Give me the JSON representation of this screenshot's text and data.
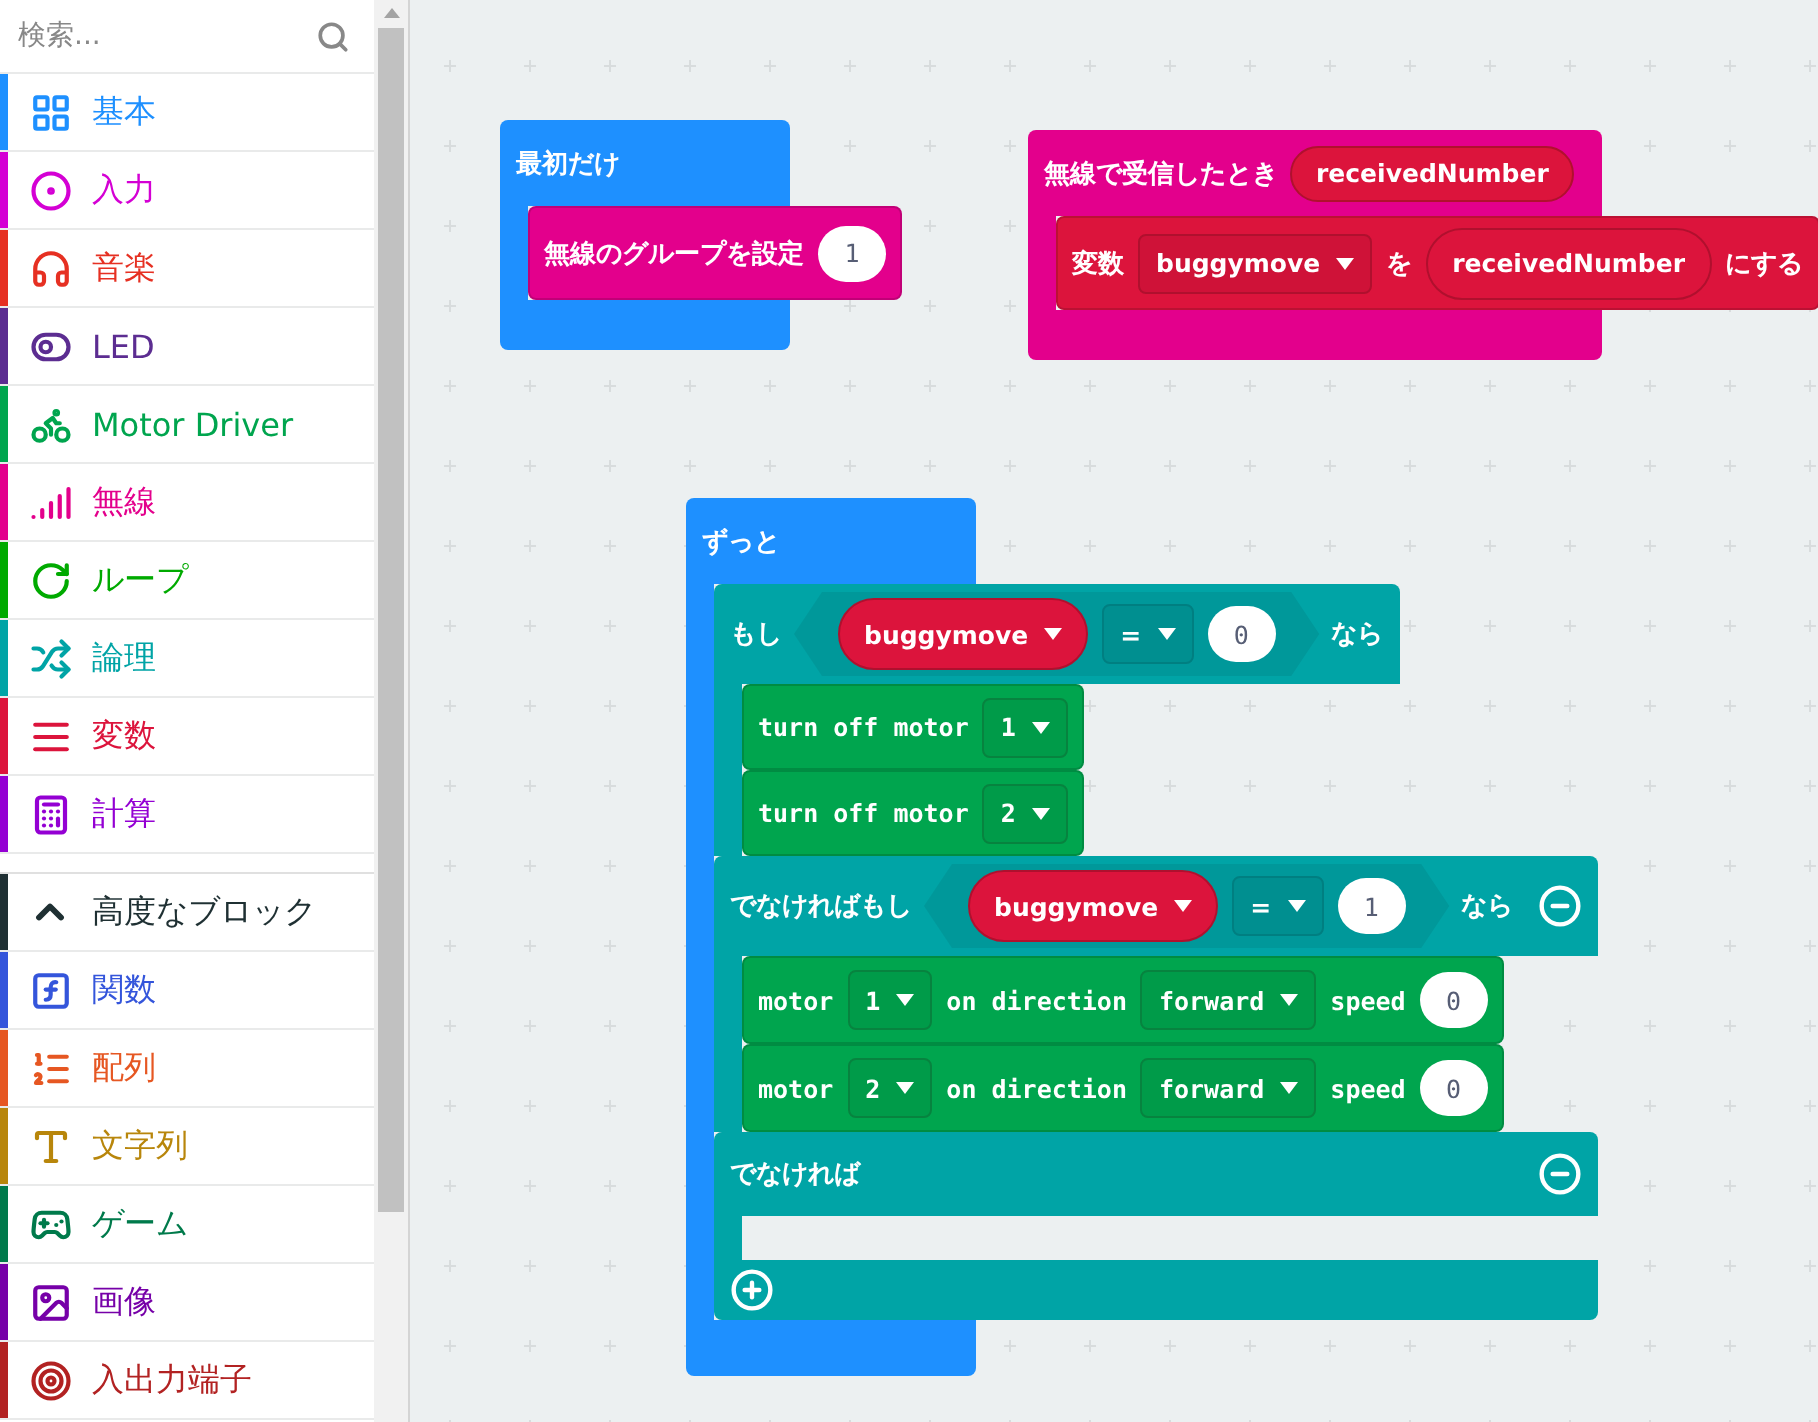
{
  "search": {
    "placeholder": "検索..."
  },
  "categories": [
    {
      "label": "基本",
      "color": "#1e90ff",
      "kind": "grid"
    },
    {
      "label": "入力",
      "color": "#d400d4",
      "kind": "target"
    },
    {
      "label": "音楽",
      "color": "#e63022",
      "kind": "headphones"
    },
    {
      "label": "LED",
      "color": "#5c2d91",
      "kind": "toggle"
    },
    {
      "label": "Motor Driver",
      "color": "#00a54e",
      "kind": "bike"
    },
    {
      "label": "無線",
      "color": "#e3008c",
      "kind": "signal"
    },
    {
      "label": "ループ",
      "color": "#00aa00",
      "kind": "loop"
    },
    {
      "label": "論理",
      "color": "#00a4a6",
      "kind": "shuffle"
    },
    {
      "label": "変数",
      "color": "#dc143c",
      "kind": "bars"
    },
    {
      "label": "計算",
      "color": "#9400d3",
      "kind": "calculator"
    }
  ],
  "advanced": {
    "label": "高度なブロック",
    "expanded": true
  },
  "advanced_categories": [
    {
      "label": "関数",
      "color": "#3455db",
      "kind": "function"
    },
    {
      "label": "配列",
      "color": "#e65722",
      "kind": "list"
    },
    {
      "label": "文字列",
      "color": "#b8860b",
      "kind": "text"
    },
    {
      "label": "ゲーム",
      "color": "#007a4b",
      "kind": "gamepad"
    },
    {
      "label": "画像",
      "color": "#7600a8",
      "kind": "image"
    },
    {
      "label": "入出力端子",
      "color": "#b22222",
      "kind": "pin"
    }
  ],
  "workspace": {
    "on_start": {
      "title": "最初だけ",
      "statement": {
        "label": "無線のグループを設定",
        "value": "1"
      }
    },
    "on_received": {
      "title": "無線で受信したとき",
      "parameter": "receivedNumber",
      "statement": {
        "label": "変数",
        "variable": "buggymove",
        "connector": "を",
        "value": "receivedNumber",
        "suffix": "にする"
      }
    },
    "forever": {
      "title": "ずっと",
      "if_block": {
        "branches": [
          {
            "label": "もし",
            "variable": "buggymove",
            "operator": "=",
            "value": "0",
            "then_label": "なら",
            "removable": false,
            "body": [
              {
                "kind": "turn_off",
                "label": "turn off motor",
                "motor": "1"
              },
              {
                "kind": "turn_off",
                "label": "turn off motor",
                "motor": "2"
              }
            ]
          },
          {
            "label": "でなければもし",
            "variable": "buggymove",
            "operator": "=",
            "value": "1",
            "then_label": "なら",
            "removable": true,
            "body": [
              {
                "kind": "run",
                "label": "motor",
                "motor": "1",
                "direction_label": "on direction",
                "direction": "forward",
                "speed_label": "speed",
                "speed": "0"
              },
              {
                "kind": "run",
                "label": "motor",
                "motor": "2",
                "direction_label": "on direction",
                "direction": "forward",
                "speed_label": "speed",
                "speed": "0"
              }
            ]
          }
        ],
        "else": {
          "label": "でなければ",
          "removable": true
        }
      }
    }
  }
}
